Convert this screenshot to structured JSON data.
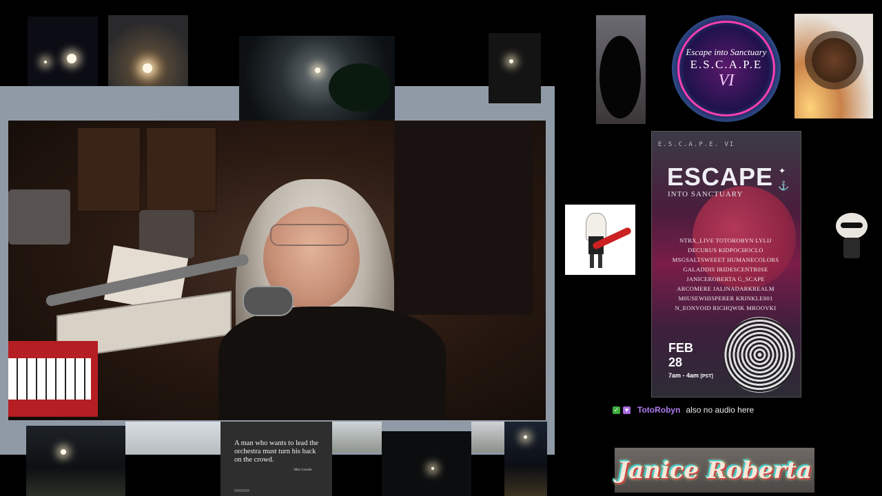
{
  "logo": {
    "line1": "Escape into Sanctuary",
    "line2": "E.S.C.A.P.E",
    "line3": "VI"
  },
  "poster": {
    "header": "E.S.C.A.P.E. VI",
    "title": "ESCAPE",
    "subtitle": "INTO SANCTUARY",
    "lineup": [
      "NTRX_LIVE  TOTOROBYN  LYLIJ",
      "DECURUS  KIDPOCHOCLO",
      "MSGSALTSWEEET  HUMANECOLORS",
      "GALADDIS  IRIDESCENTR0SE",
      "JANICEROBERTA  G_SCAPE",
      "ARCOMERE  JALINADARKREALM",
      "M0USEWHISPERER  KRINKLE801",
      "N_EONVOID  RICHQWIK  MROOVKI"
    ],
    "date_month": "FEB",
    "date_day": "28",
    "time": "7am - 4am",
    "timezone": "[PST]"
  },
  "chat": {
    "user": "TotoRobyn",
    "message": "also no audio here"
  },
  "banner": {
    "name": "Janice Roberta"
  },
  "quote": {
    "text": "A man who wants to lead the orchestra must turn his back on the crowd.",
    "author": "- Max Lucado"
  },
  "colors": {
    "frame": "#8f9aa6",
    "chat_user": "#b07cf0",
    "poster_accent": "#7a1d48"
  }
}
